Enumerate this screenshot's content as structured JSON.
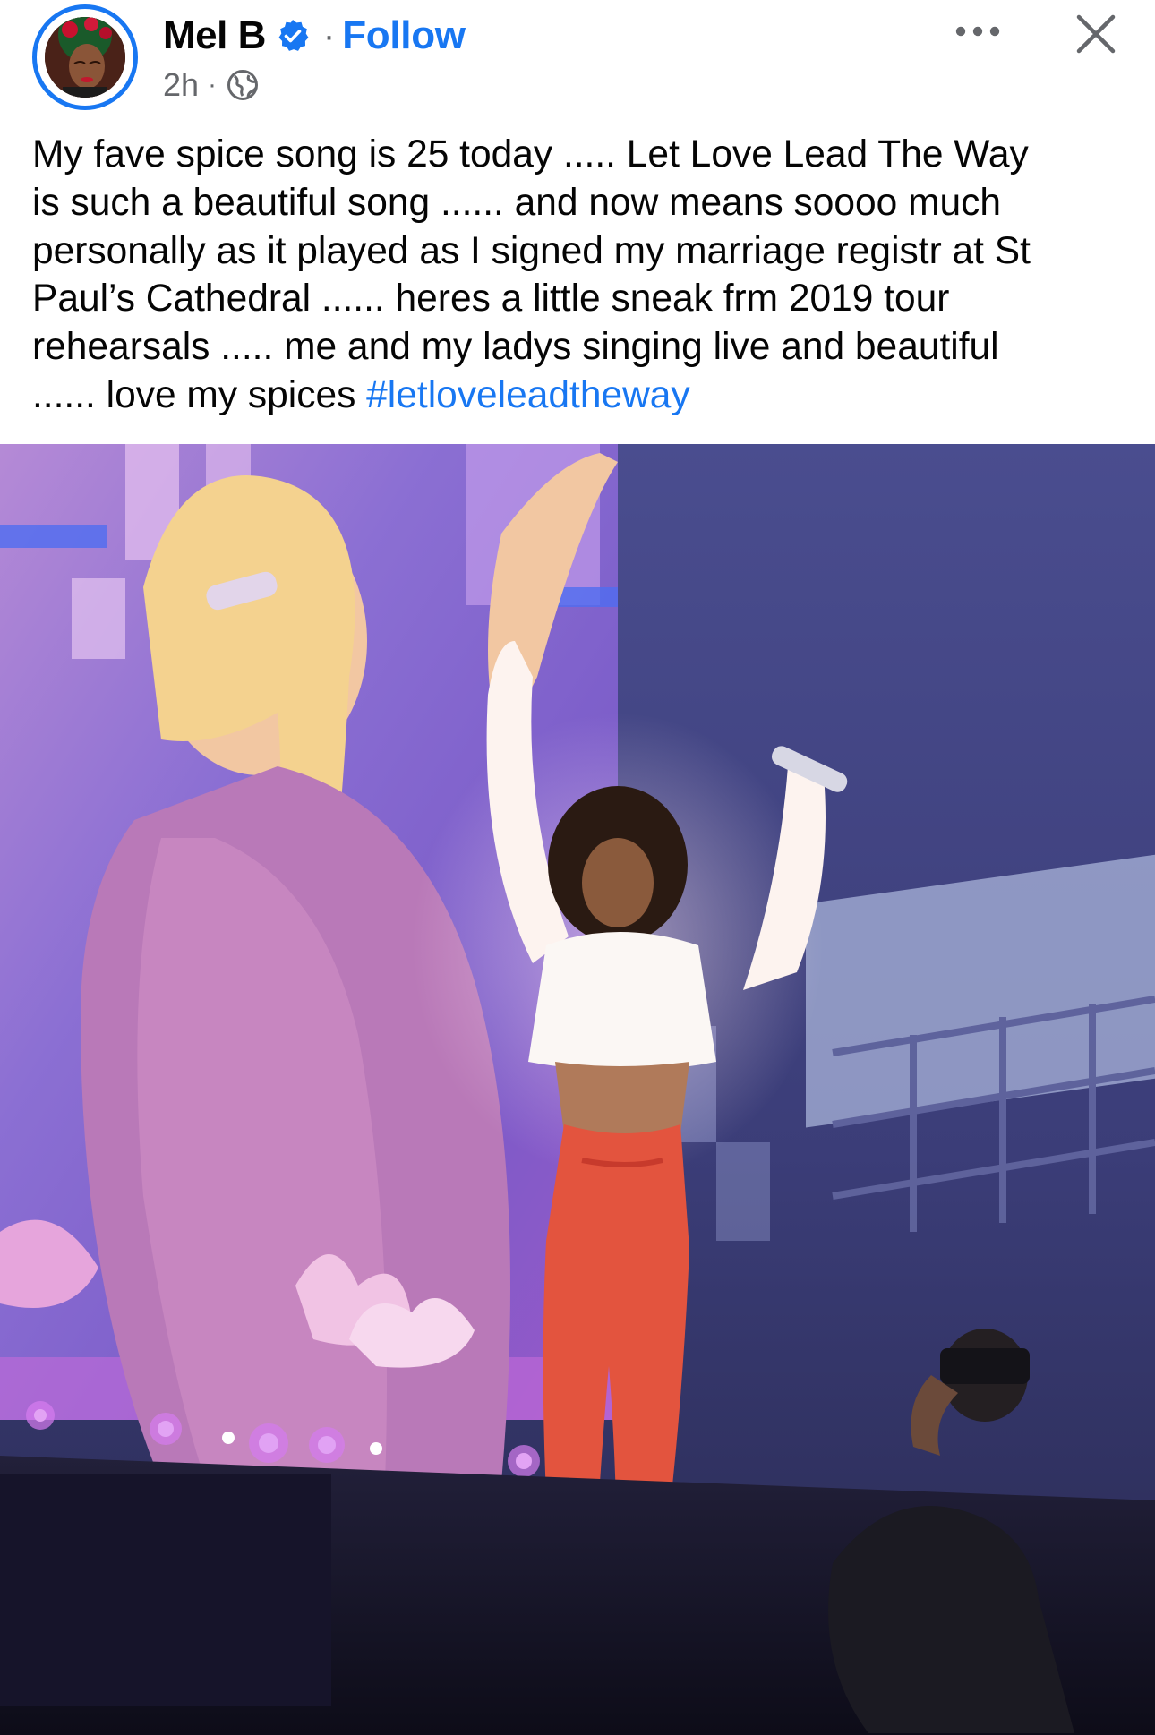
{
  "post": {
    "author": {
      "name": "Mel B",
      "verified": true,
      "avatar_icon": "profile-photo"
    },
    "follow_label": "Follow",
    "separator": "·",
    "timestamp": "2h",
    "audience_icon": "globe-icon",
    "text_lines": [
      "My fave spice song is 25 today ..... Let Love Lead The Way",
      "is such a beautiful song ...... and now means soooo much",
      "personally as it played as I signed my marriage registr at St",
      "Paul’s Cathedral ...... heres a little sneak frm 2019 tour",
      "rehearsals ..... me and my ladys singing live and beautiful",
      "...... love my spices "
    ],
    "hashtag": "#letloveleadtheway",
    "media": {
      "type": "photo"
    }
  },
  "actions": {
    "more_icon": "more-options-icon",
    "close_icon": "close-icon"
  },
  "colors": {
    "link_blue": "#1877f2",
    "secondary_text": "#65676b",
    "primary_text": "#050505"
  }
}
